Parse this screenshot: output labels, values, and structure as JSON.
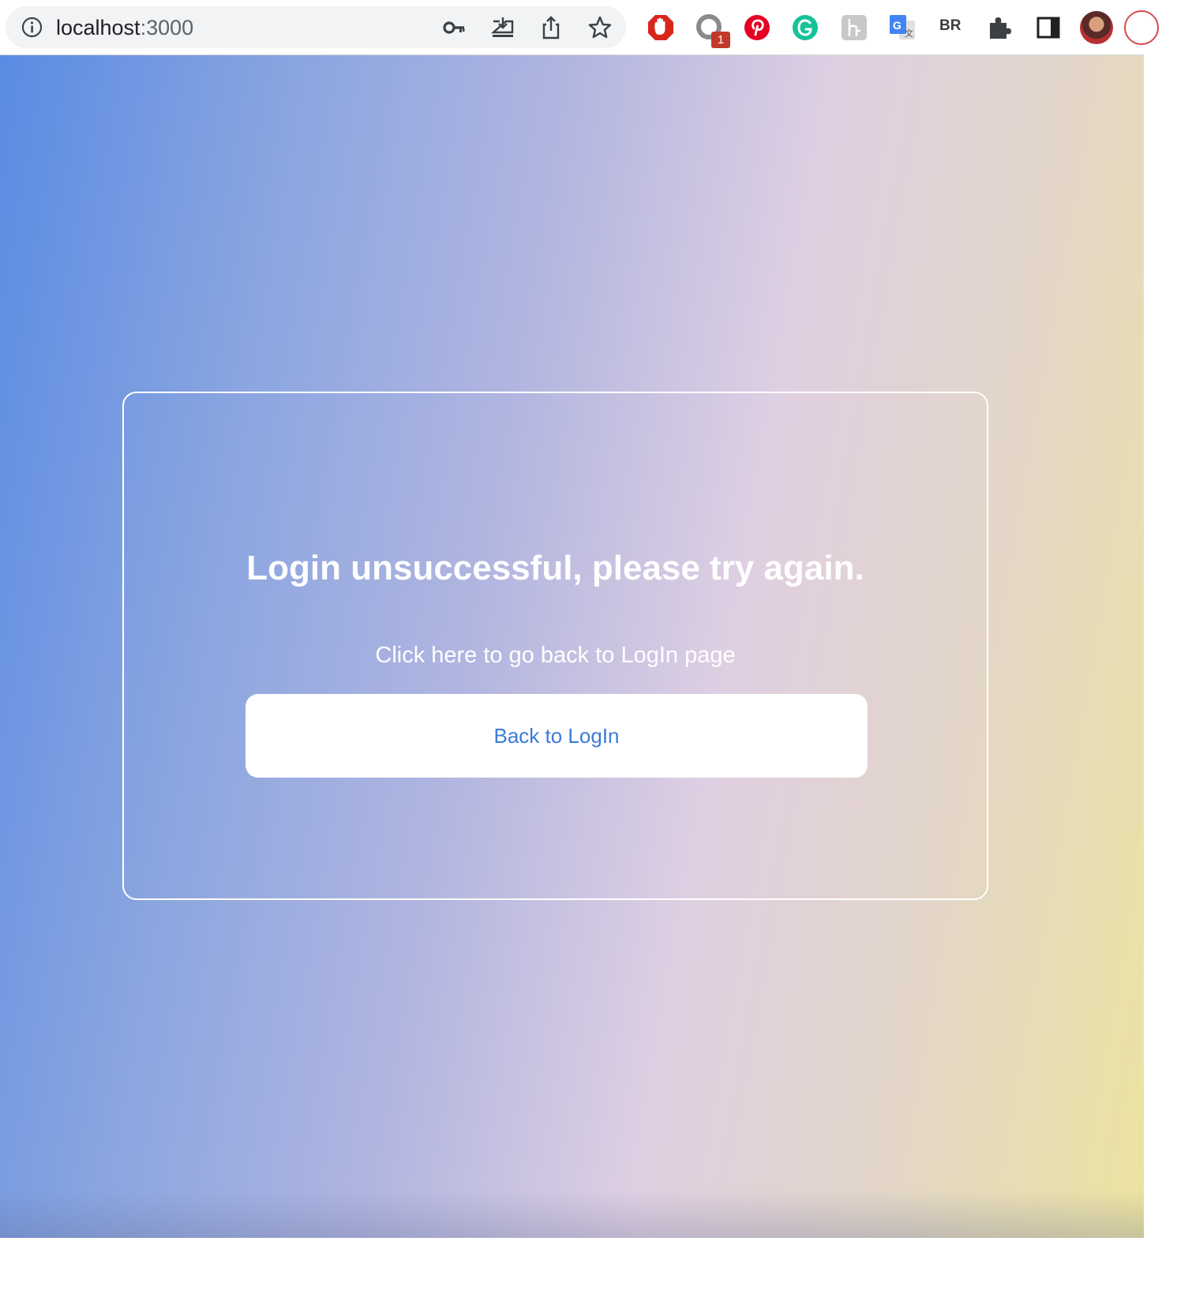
{
  "browser": {
    "url_host": "localhost",
    "url_port": ":3000",
    "notification_badge": "1",
    "br_extension": "BR"
  },
  "page": {
    "title": "Login unsuccessful, please try again.",
    "subtitle": "Click here to go back to LogIn page",
    "back_button_label": "Back to LogIn"
  },
  "colors": {
    "gradient_start": "#5a8be3",
    "gradient_mid": "#dfcfe2",
    "gradient_end": "#ece3a0",
    "button_text": "#3b7bd8"
  }
}
